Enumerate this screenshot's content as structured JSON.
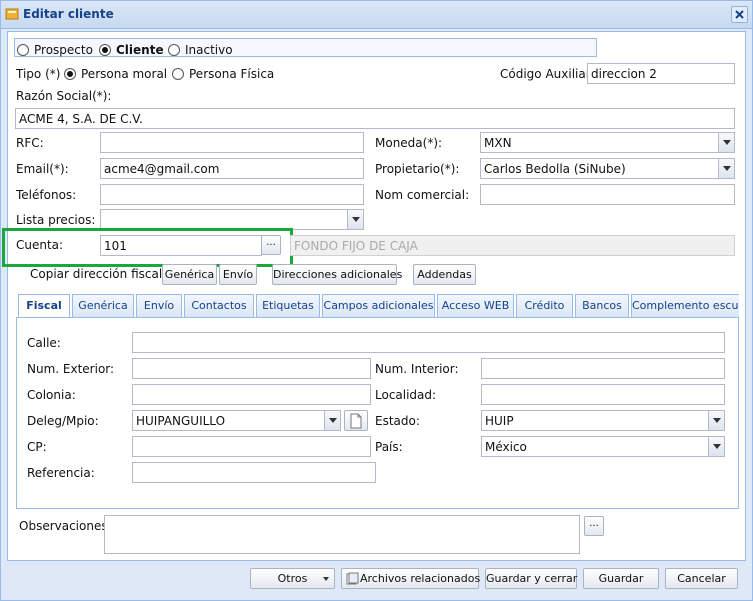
{
  "window": {
    "title": "Editar cliente"
  },
  "status": {
    "options": [
      "Prospecto",
      "Cliente",
      "Inactivo"
    ],
    "selected": "Cliente"
  },
  "tipo": {
    "label": "Tipo (*)",
    "options": [
      "Persona moral",
      "Persona Física"
    ],
    "selected": "Persona moral"
  },
  "codigo_auxiliar": {
    "label": "Código Auxiliar:",
    "value": "direccion 2"
  },
  "razon_social": {
    "label": "Razón Social(*):",
    "value": "ACME 4, S.A. DE C.V."
  },
  "rfc": {
    "label": "RFC:",
    "value": ""
  },
  "moneda": {
    "label": "Moneda(*):",
    "value": "MXN"
  },
  "email": {
    "label": "Email(*):",
    "value": "acme4@gmail.com"
  },
  "propietario": {
    "label": "Propietario(*):",
    "value": "Carlos Bedolla (SiNube)"
  },
  "telefonos": {
    "label": "Teléfonos:",
    "value": ""
  },
  "nom_comercial": {
    "label": "Nom comercial:",
    "value": ""
  },
  "lista_precios": {
    "label": "Lista precios:",
    "value": ""
  },
  "cuenta": {
    "label": "Cuenta:",
    "value": "101",
    "button": "...",
    "description": "FONDO FIJO DE CAJA"
  },
  "copiar": {
    "label": "Copiar dirección fiscal a:",
    "generica": "Genérica",
    "envio": "Envío"
  },
  "buttons": {
    "direcciones": "Direcciones adicionales",
    "addendas": "Addendas"
  },
  "tabs": [
    "Fiscal",
    "Genérica",
    "Envío",
    "Contactos",
    "Etiquetas",
    "Campos adicionales",
    "Acceso WEB",
    "Crédito",
    "Bancos",
    "Complemento escue"
  ],
  "fiscal": {
    "calle": {
      "label": "Calle:",
      "value": ""
    },
    "num_exterior": {
      "label": "Num. Exterior:",
      "value": ""
    },
    "num_interior": {
      "label": "Num. Interior:",
      "value": ""
    },
    "colonia": {
      "label": "Colonia:",
      "value": ""
    },
    "localidad": {
      "label": "Localidad:",
      "value": ""
    },
    "deleg": {
      "label": "Deleg/Mpio:",
      "value": "HUIPANGUILLO"
    },
    "estado": {
      "label": "Estado:",
      "value": "HUIP"
    },
    "cp": {
      "label": "CP:",
      "value": ""
    },
    "pais": {
      "label": "País:",
      "value": "México"
    },
    "referencia": {
      "label": "Referencia:",
      "value": ""
    }
  },
  "observaciones": {
    "label": "Observaciones",
    "value": "",
    "button": "..."
  },
  "footer": {
    "otros": "Otros",
    "archivos": "Archivos relacionados",
    "guardar_cerrar": "Guardar y cerrar",
    "guardar": "Guardar",
    "cancelar": "Cancelar"
  },
  "colors": {
    "accent": "#15428b",
    "highlight": "#1aa83a",
    "border": "#99bbe8"
  }
}
